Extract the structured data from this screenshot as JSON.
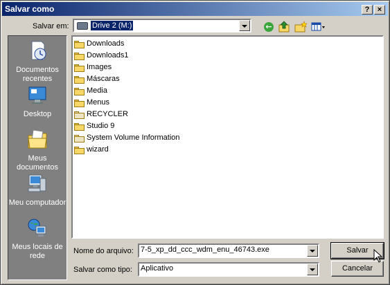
{
  "window": {
    "title": "Salvar como",
    "help_glyph": "?",
    "close_glyph": "×"
  },
  "lookin": {
    "label": "Salvar em:",
    "value": "Drive 2 (M:)"
  },
  "toolbar": {
    "back_glyph": "←"
  },
  "places": [
    {
      "label": "Documentos recentes",
      "icon": "recent-documents-icon"
    },
    {
      "label": "Desktop",
      "icon": "desktop-icon"
    },
    {
      "label": "Meus documentos",
      "icon": "my-documents-icon"
    },
    {
      "label": "Meu computador",
      "icon": "my-computer-icon"
    },
    {
      "label": "Meus locais de rede",
      "icon": "network-places-icon"
    }
  ],
  "files": [
    {
      "name": "Downloads",
      "kind": "folder"
    },
    {
      "name": "Downloads1",
      "kind": "folder"
    },
    {
      "name": "Images",
      "kind": "folder"
    },
    {
      "name": "Máscaras",
      "kind": "folder"
    },
    {
      "name": "Media",
      "kind": "folder"
    },
    {
      "name": "Menus",
      "kind": "folder"
    },
    {
      "name": "RECYCLER",
      "kind": "system-folder"
    },
    {
      "name": "Studio 9",
      "kind": "folder"
    },
    {
      "name": "System Volume Information",
      "kind": "system-folder"
    },
    {
      "name": "wizard",
      "kind": "folder"
    }
  ],
  "filename": {
    "label": "Nome do arquivo:",
    "value": "7-5_xp_dd_ccc_wdm_enu_46743.exe"
  },
  "filetype": {
    "label": "Salvar como tipo:",
    "value": "Aplicativo"
  },
  "buttons": {
    "save": "Salvar",
    "cancel": "Cancelar"
  },
  "colors": {
    "titlebar_start": "#0a246a",
    "titlebar_end": "#a6caf0",
    "face": "#d4d0c8",
    "places_bg": "#808080"
  }
}
